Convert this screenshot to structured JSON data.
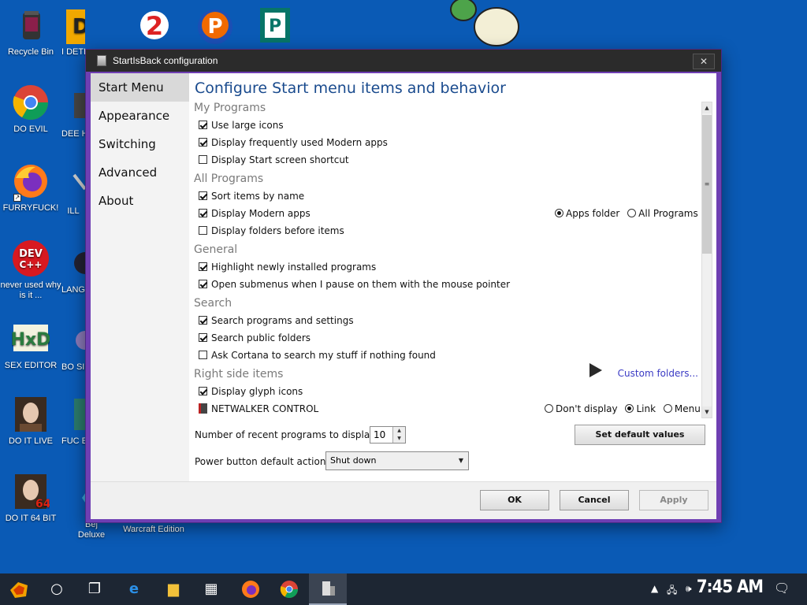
{
  "desktop": {
    "icons": [
      {
        "label": "Recycle Bin",
        "icon": "recycle-bin-icon"
      },
      {
        "label": "DO EVIL",
        "icon": "chrome-icon"
      },
      {
        "label": "FURRYFUCK!",
        "icon": "firefox-icon"
      },
      {
        "label": "never used why is it ...",
        "icon": "devcpp-icon"
      },
      {
        "label": "SEX EDITOR",
        "icon": "hxd-icon"
      },
      {
        "label": "DO IT LIVE",
        "icon": "portrait-icon"
      },
      {
        "label": "DO IT 64 BIT",
        "icon": "portrait-64-icon"
      }
    ],
    "col2_labels": [
      "I DETE",
      "DEE HAF",
      "ILL",
      "LANG",
      "BO SIM",
      "FUC E",
      "Bej Deluxe"
    ],
    "extra_label": "Warcraft Edition"
  },
  "dialog": {
    "title": "StartIsBack configuration",
    "close_glyph": "✕",
    "sidebar": [
      {
        "label": "Start Menu",
        "active": true
      },
      {
        "label": "Appearance",
        "active": false
      },
      {
        "label": "Switching",
        "active": false
      },
      {
        "label": "Advanced",
        "active": false
      },
      {
        "label": "About",
        "active": false
      }
    ],
    "heading": "Configure Start menu items and behavior",
    "sections": {
      "my_programs": "My Programs",
      "all_programs": "All Programs",
      "general": "General",
      "search": "Search",
      "right_side": "Right side items"
    },
    "options": {
      "large_icons": "Use large icons",
      "modern_apps_freq": "Display frequently used Modern apps",
      "start_screen_shortcut": "Display Start screen shortcut",
      "sort_by_name": "Sort items by name",
      "display_modern_apps": "Display Modern apps",
      "folders_before_items": "Display folders before items",
      "highlight_new": "Highlight newly installed programs",
      "open_submenus": "Open submenus when I pause on them with the mouse pointer",
      "search_programs": "Search programs and settings",
      "search_public": "Search public folders",
      "ask_cortana": "Ask Cortana to search my stuff if nothing found",
      "glyph_icons": "Display glyph icons",
      "netwalker": "NETWALKER CONTROL"
    },
    "checked": {
      "large_icons": true,
      "modern_apps_freq": true,
      "start_screen_shortcut": false,
      "sort_by_name": true,
      "display_modern_apps": true,
      "folders_before_items": false,
      "highlight_new": true,
      "open_submenus": true,
      "search_programs": true,
      "search_public": true,
      "ask_cortana": false,
      "glyph_icons": true
    },
    "modern_apps_radios": {
      "apps_folder": "Apps folder",
      "all_programs": "All Programs",
      "selected": "apps_folder"
    },
    "netwalker_radios": {
      "dont_display": "Don't display",
      "link": "Link",
      "menu": "Menu",
      "selected": "link"
    },
    "custom_folders": "Custom folders...",
    "recent_label": "Number of recent programs to display:",
    "recent_value": "10",
    "power_label": "Power button default action:",
    "power_value": "Shut down",
    "set_default": "Set default values",
    "ok": "OK",
    "cancel": "Cancel",
    "apply": "Apply"
  },
  "taskbar": {
    "clock": "7:45 AM",
    "icons": [
      "start-icon",
      "cortana-icon",
      "task-view-icon",
      "edge-icon",
      "file-explorer-icon",
      "store-icon",
      "firefox-icon",
      "chrome-icon",
      "startisback-icon"
    ]
  }
}
